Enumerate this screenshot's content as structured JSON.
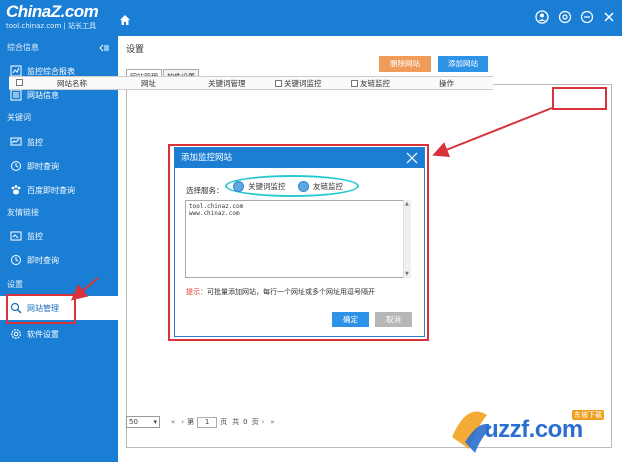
{
  "app": {
    "brand": "ChinaZ.com",
    "subtitle": "tool.chinaz.com | 站长工具"
  },
  "sidebar": {
    "groups": [
      {
        "label": "综合信息"
      },
      {
        "label": "关键词"
      },
      {
        "label": "友情链接"
      },
      {
        "label": "设置"
      }
    ],
    "items": [
      {
        "label": "监控综合报表",
        "icon": "monitor-report-icon"
      },
      {
        "label": "网站信息",
        "icon": "site-info-icon"
      },
      {
        "label": "监控",
        "icon": "monitor-icon"
      },
      {
        "label": "即时查询",
        "icon": "instant-query-icon"
      },
      {
        "label": "百度即时查询",
        "icon": "baidu-paw-icon"
      },
      {
        "label": "监控",
        "icon": "monitor-icon"
      },
      {
        "label": "即时查询",
        "icon": "instant-query-icon"
      },
      {
        "label": "网站管理",
        "icon": "site-manage-icon"
      },
      {
        "label": "软件设置",
        "icon": "gear-icon"
      }
    ]
  },
  "main": {
    "title": "设置",
    "tabs": [
      {
        "label": "网站管理"
      },
      {
        "label": "软件设置"
      }
    ],
    "buttons": {
      "delete": "删除网站",
      "add": "添加网站"
    },
    "table": {
      "columns": [
        "网站名称",
        "网址",
        "关键词管理",
        "关键词监控",
        "友链监控",
        "操作"
      ]
    },
    "pager": {
      "page_size": "50",
      "first_prev": "«",
      "prev": "‹",
      "page_prefix": "第",
      "page_value": "1",
      "page_suffix": "页",
      "total_prefix": "共",
      "total_pages": "0",
      "total_suffix": "页",
      "next": "›",
      "last": "»"
    }
  },
  "dialog": {
    "title": "添加监控网站",
    "service_label": "选择服务：",
    "options": [
      {
        "label": "关键词监控"
      },
      {
        "label": "友链监控"
      }
    ],
    "textarea_value": "tool.chinaz.com\nwww.chinaz.com",
    "hint_prefix": "提示：",
    "hint_text": "可批量添加网站，每行一个网址或多个网址用逗号隔开",
    "ok": "确定",
    "cancel": "取消"
  },
  "watermark": {
    "text": "uzzf.com",
    "badge": "东坡下载"
  },
  "colors": {
    "primary": "#1a7fd4",
    "accent_orange": "#f19b5a",
    "annotation_red": "#d8323a",
    "annotation_cyan": "#28c8d0"
  }
}
